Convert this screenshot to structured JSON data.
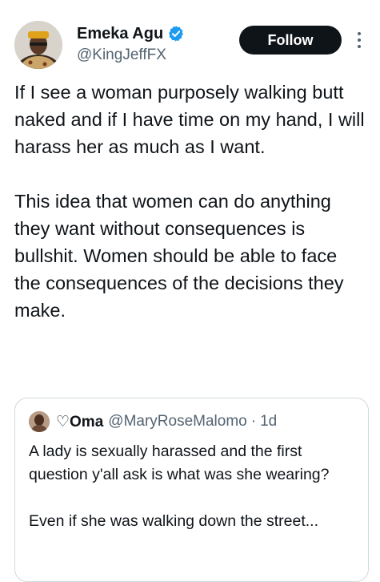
{
  "author": {
    "display_name": "Emeka Agu",
    "handle": "@KingJeffFX",
    "verified": true
  },
  "follow_button": {
    "label": "Follow"
  },
  "tweet": {
    "paragraphs": [
      "If I see a woman purposely walking butt naked and if I have time on my hand, I will harass her as much as I want.",
      "This idea that women can do anything they want without consequences is bullshit. Women should be able to face the consequences of the decisions they make."
    ]
  },
  "quoted_tweet": {
    "display_name": "♡Oma",
    "handle": "@MaryRoseMalomo",
    "separator": "·",
    "time": "1d",
    "paragraphs": [
      "A lady is sexually harassed and the first question y'all ask is what was she wearing?",
      "Even if she was walking down the street..."
    ]
  },
  "colors": {
    "text_primary": "#0f1419",
    "text_secondary": "#536471",
    "verified_blue": "#1d9bf0",
    "follow_bg": "#0f1419",
    "border": "#cfd9de"
  },
  "icons": {
    "verified": "verified-badge-icon",
    "more": "more-options-icon"
  }
}
